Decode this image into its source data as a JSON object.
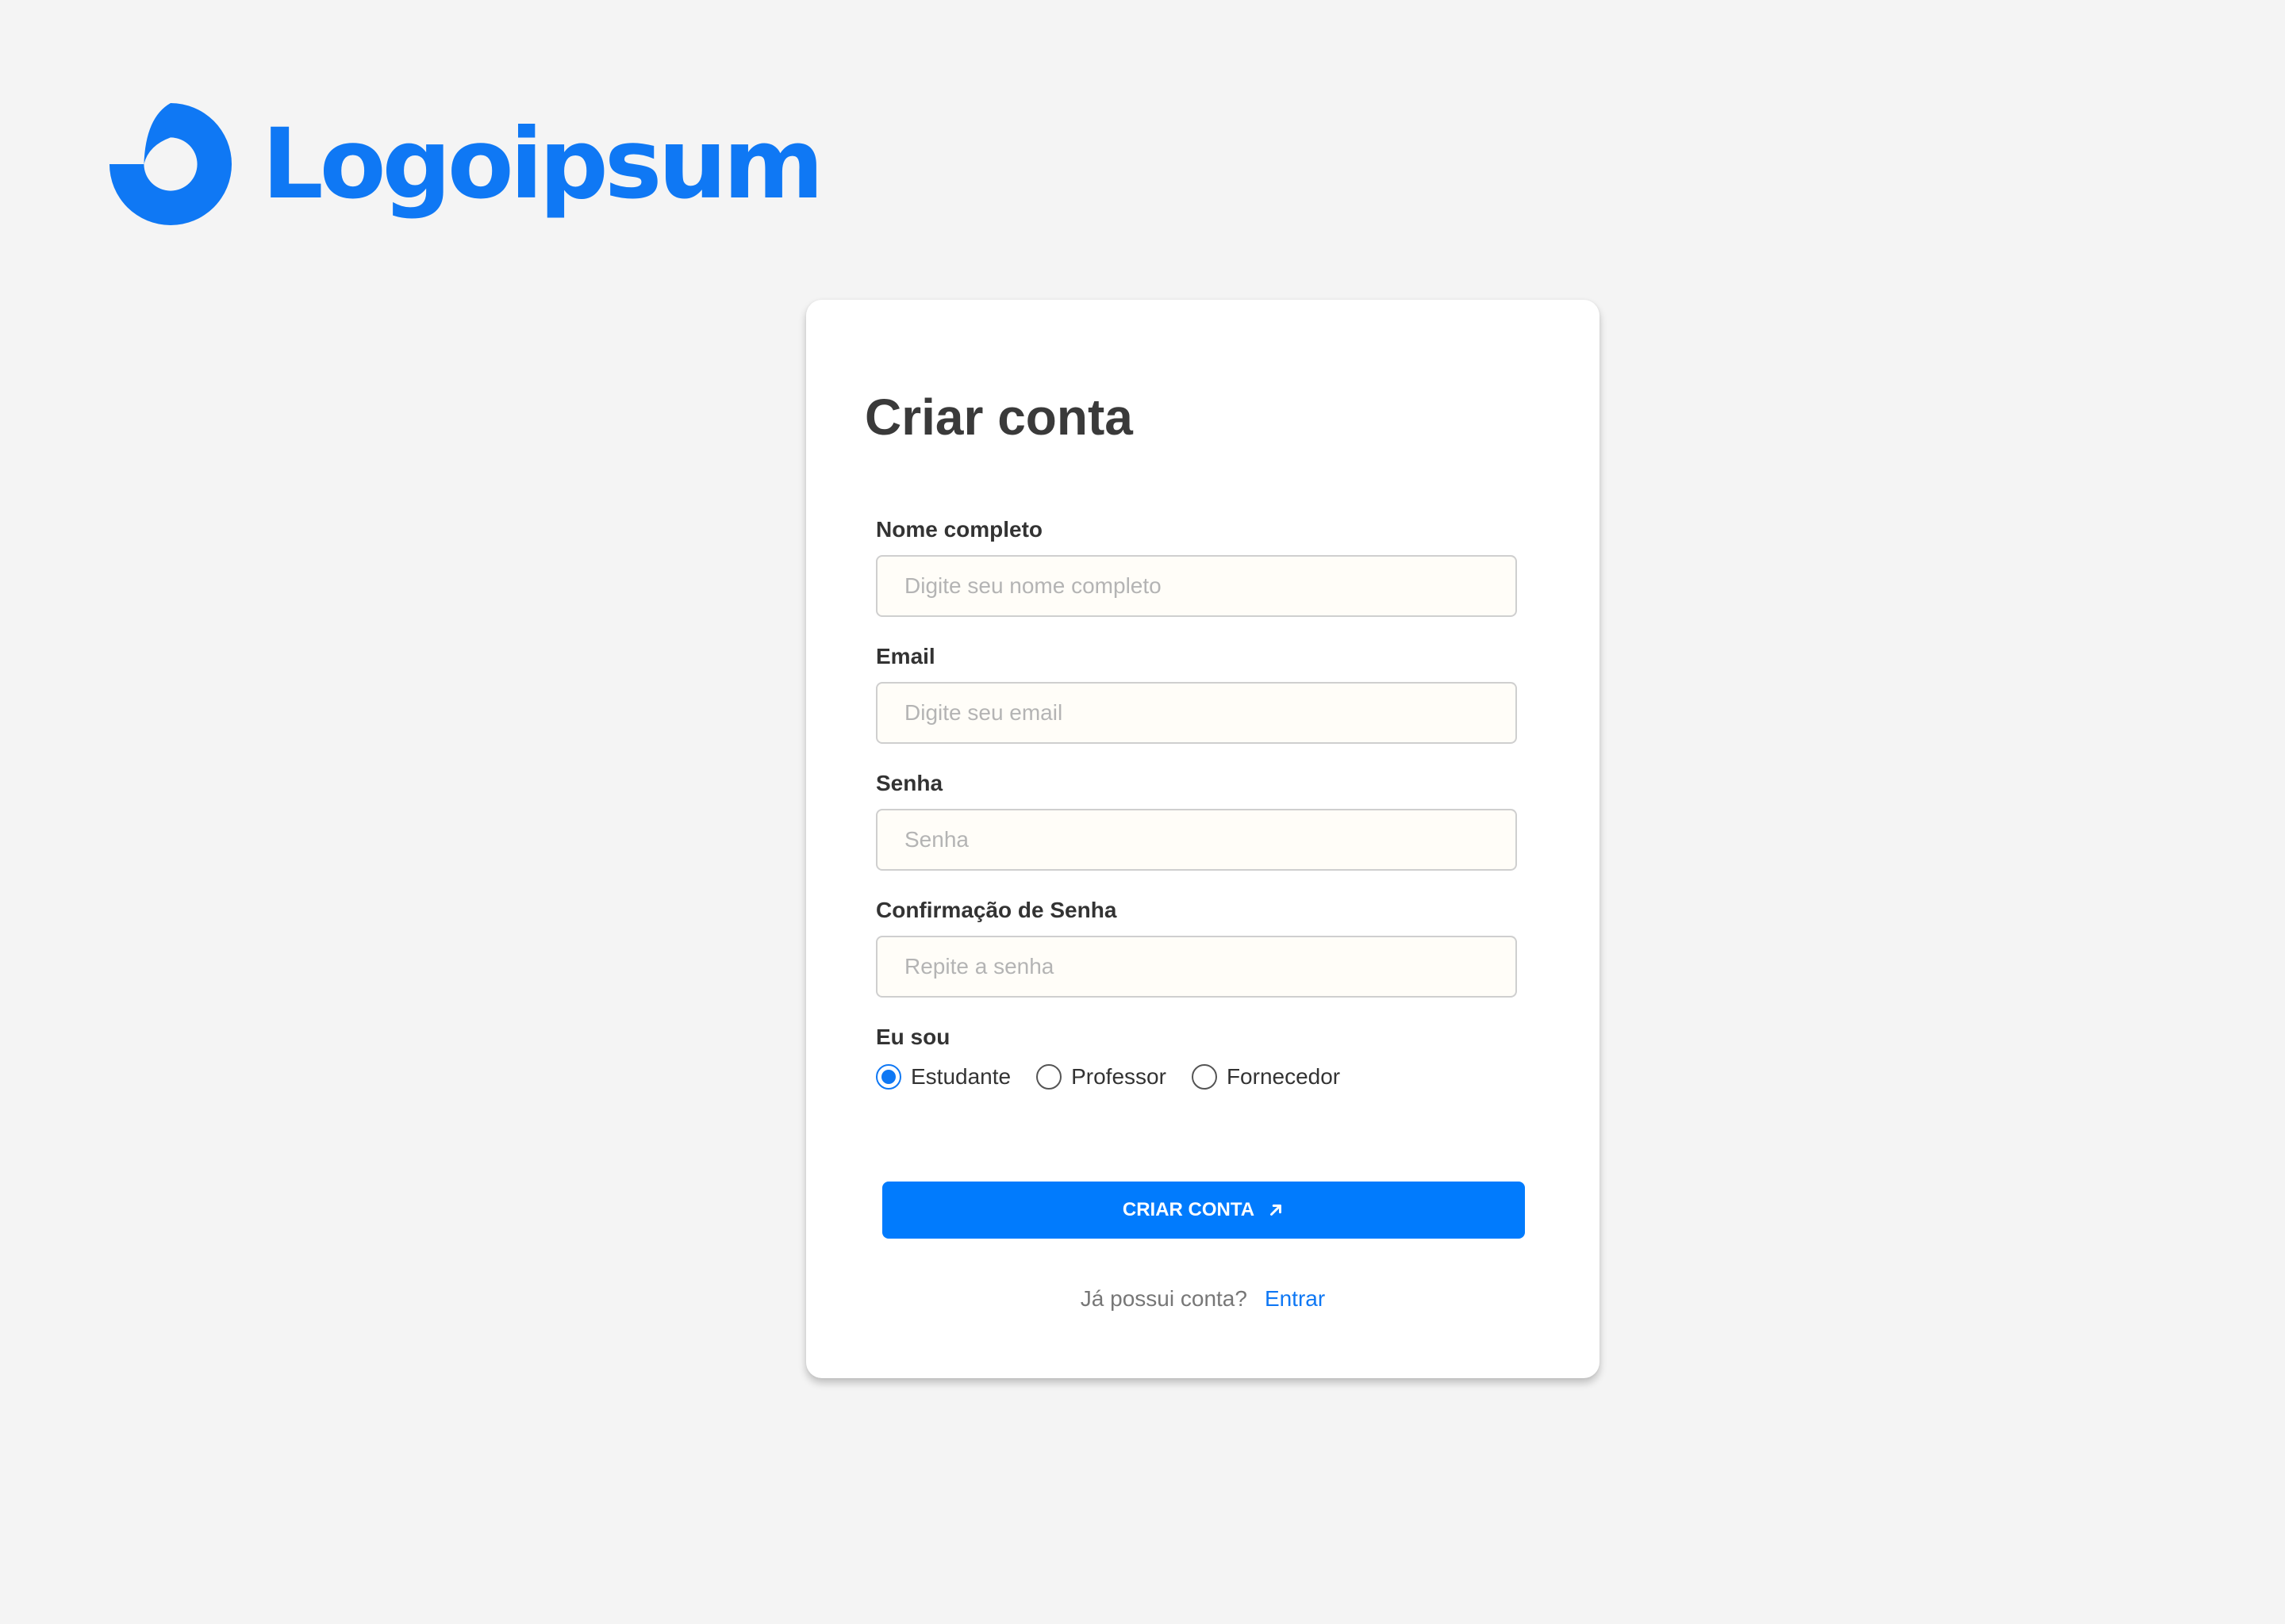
{
  "brand": {
    "name": "Logoipsum",
    "icon": "logoipsum-mark-icon",
    "color": "#0f78f4"
  },
  "form": {
    "title": "Criar conta",
    "fields": [
      {
        "label": "Nome completo",
        "placeholder": "Digite seu nome completo",
        "value": ""
      },
      {
        "label": "Email",
        "placeholder": "Digite seu email",
        "value": ""
      },
      {
        "label": "Senha",
        "placeholder": "Senha",
        "value": ""
      },
      {
        "label": "Confirmação de Senha",
        "placeholder": "Repite a senha",
        "value": ""
      }
    ],
    "role": {
      "label": "Eu sou",
      "options": [
        "Estudante",
        "Professor",
        "Fornecedor"
      ],
      "selected": "Estudante"
    },
    "submit": {
      "label": "CRIAR CONTA",
      "icon": "arrow-up-right-icon",
      "color": "#017bfd"
    },
    "footer": {
      "question": "Já possui conta?",
      "link": "Entrar"
    }
  },
  "colors": {
    "background": "#f4f4f4",
    "card": "#ffffff",
    "accent": "#0f78f4",
    "input_fill": "#fffdf8"
  }
}
